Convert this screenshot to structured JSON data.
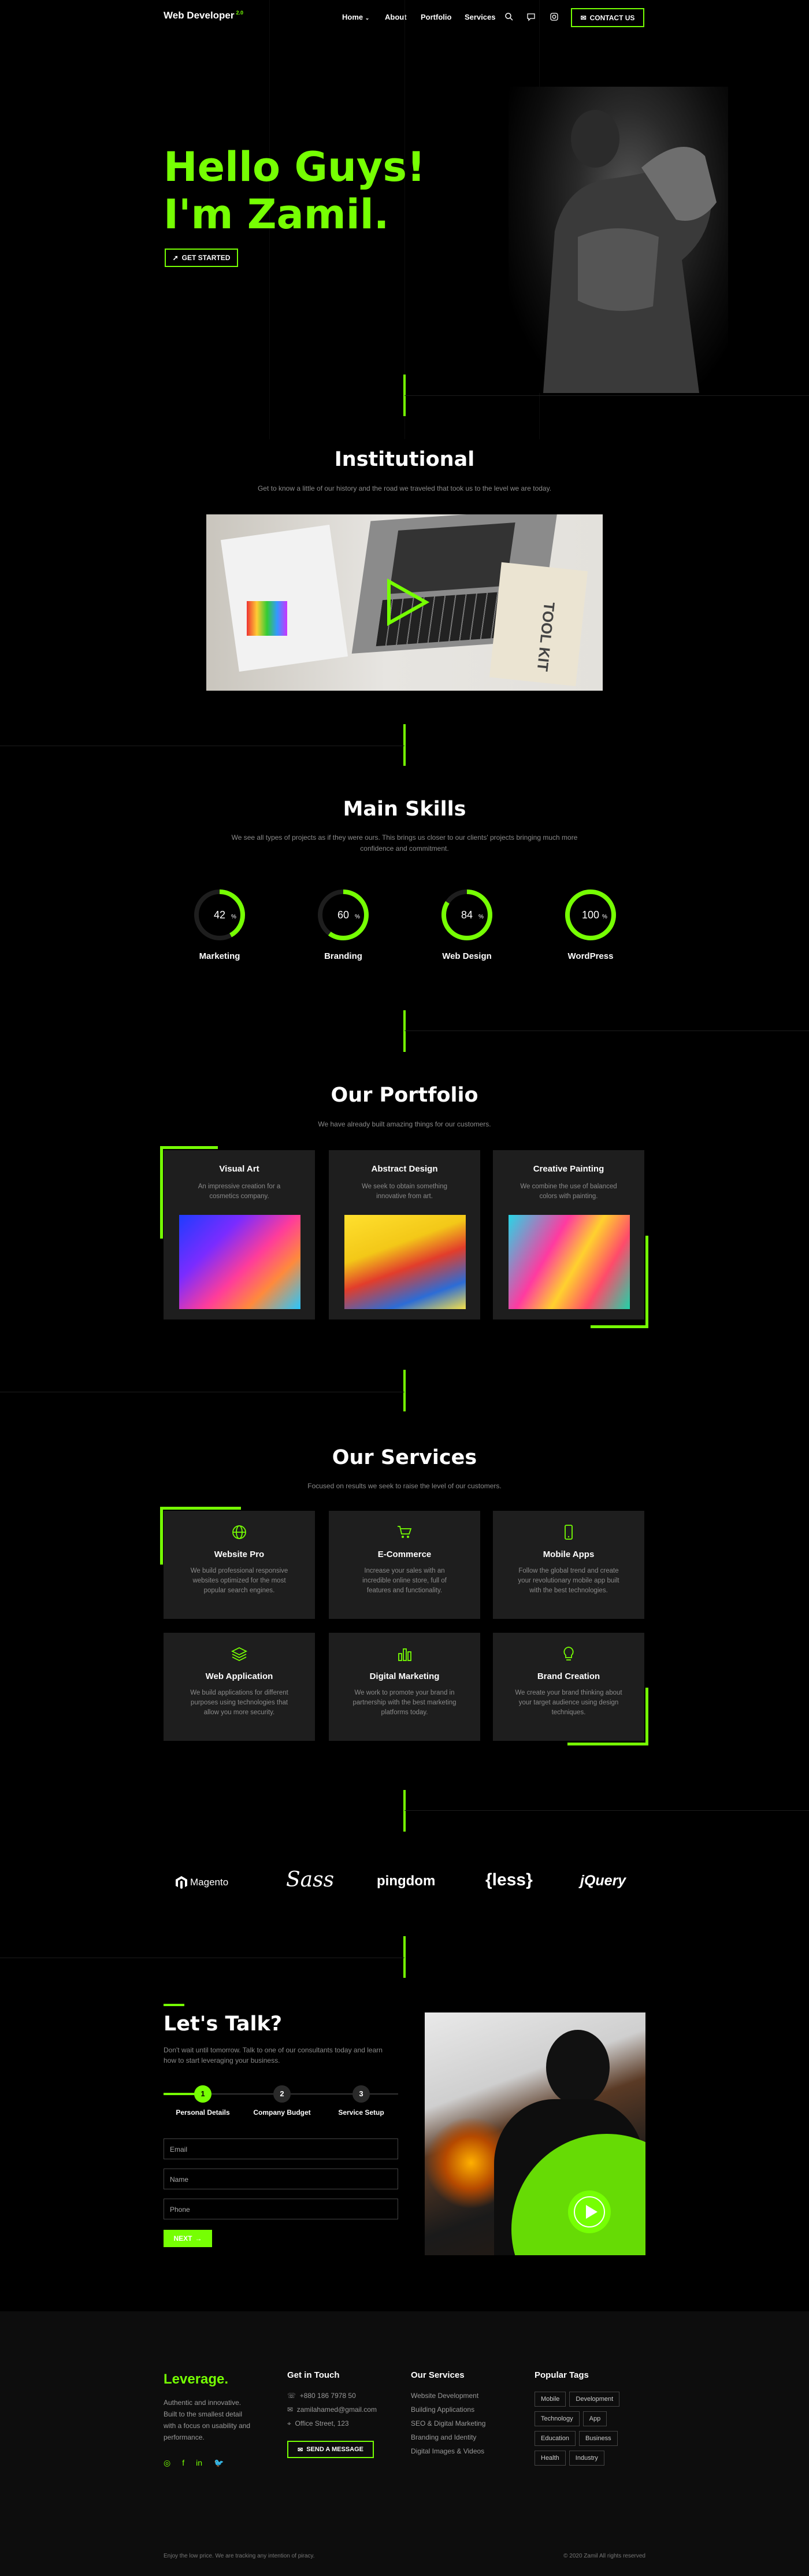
{
  "header": {
    "logo": "Web Developer",
    "logo_badge": "2.0",
    "nav": [
      "Home",
      "About",
      "Portfolio",
      "Services"
    ],
    "contact": "CONTACT US"
  },
  "hero": {
    "line1": "Hello Guys!",
    "line2": "I'm Zamil.",
    "cta": "GET STARTED"
  },
  "institutional": {
    "title": "Institutional",
    "subtitle": "Get to know a little of our history and the road we traveled that took us to the level we are today.",
    "toolkit": "TOOL KIT"
  },
  "skills": {
    "title": "Main Skills",
    "subtitle": "We see all types of projects as if they were ours. This brings us closer to our clients' projects bringing much more confidence and commitment.",
    "items": [
      {
        "label": "Marketing",
        "pct": "42",
        "value": 42
      },
      {
        "label": "Branding",
        "pct": "60",
        "value": 60
      },
      {
        "label": "Web Design",
        "pct": "84",
        "value": 84
      },
      {
        "label": "WordPress",
        "pct": "100",
        "value": 100
      }
    ]
  },
  "portfolio": {
    "title": "Our Portfolio",
    "subtitle": "We have already built amazing things for our customers.",
    "items": [
      {
        "title": "Visual Art",
        "text": "An impressive creation for a cosmetics company."
      },
      {
        "title": "Abstract Design",
        "text": "We seek to obtain something innovative from art."
      },
      {
        "title": "Creative Painting",
        "text": "We combine the use of balanced colors with painting."
      }
    ]
  },
  "services": {
    "title": "Our Services",
    "subtitle": "Focused on results we seek to raise the level of our customers.",
    "items": [
      {
        "icon": "globe-icon",
        "title": "Website Pro",
        "text": "We build professional responsive websites optimized for the most popular search engines."
      },
      {
        "icon": "cart-icon",
        "title": "E-Commerce",
        "text": "Increase your sales with an incredible online store, full of features and functionality."
      },
      {
        "icon": "mobile-icon",
        "title": "Mobile Apps",
        "text": "Follow the global trend and create your revolutionary mobile app built with the best technologies."
      },
      {
        "icon": "layers-icon",
        "title": "Web Application",
        "text": "We build applications for different purposes using technologies that allow you more security."
      },
      {
        "icon": "chart-icon",
        "title": "Digital Marketing",
        "text": "We work to promote your brand in partnership with the best marketing platforms today."
      },
      {
        "icon": "bulb-icon",
        "title": "Brand Creation",
        "text": "We create your brand thinking about your target audience using design techniques."
      }
    ]
  },
  "brands": [
    "Magento",
    "Sass",
    "pingdom",
    "{less}",
    "jQuery"
  ],
  "talk": {
    "title": "Let's Talk?",
    "text": "Don't wait until tomorrow. Talk to one of our consultants today and learn how to start leveraging your business.",
    "steps": [
      {
        "n": "1",
        "label": "Personal Details"
      },
      {
        "n": "2",
        "label": "Company Budget"
      },
      {
        "n": "3",
        "label": "Service Setup"
      }
    ],
    "fields": [
      "Email",
      "Name",
      "Phone"
    ],
    "next": "NEXT"
  },
  "footer": {
    "brand": "Leverage.",
    "about": "Authentic and innovative. Built to the smallest detail with a focus on usability and performance.",
    "touch_title": "Get in Touch",
    "phone": "+880 186 7978 50",
    "email": "zamilahamed@gmail.com",
    "address": "Office Street, 123",
    "send": "SEND A MESSAGE",
    "services_title": "Our Services",
    "services": [
      "Website Development",
      "Building Applications",
      "SEO & Digital Marketing",
      "Branding and Identity",
      "Digital Images & Videos"
    ],
    "tags_title": "Popular Tags",
    "tags": [
      "Mobile",
      "Development",
      "Technology",
      "App",
      "Education",
      "Business",
      "Health",
      "Industry"
    ],
    "bottom_left": "Enjoy the low price. We are tracking any intention of piracy.",
    "bottom_right": "© 2020 Zamil All rights reserved"
  },
  "colors": {
    "accent": "#76ff03",
    "bg": "#000000",
    "card": "#1e1e1e"
  }
}
